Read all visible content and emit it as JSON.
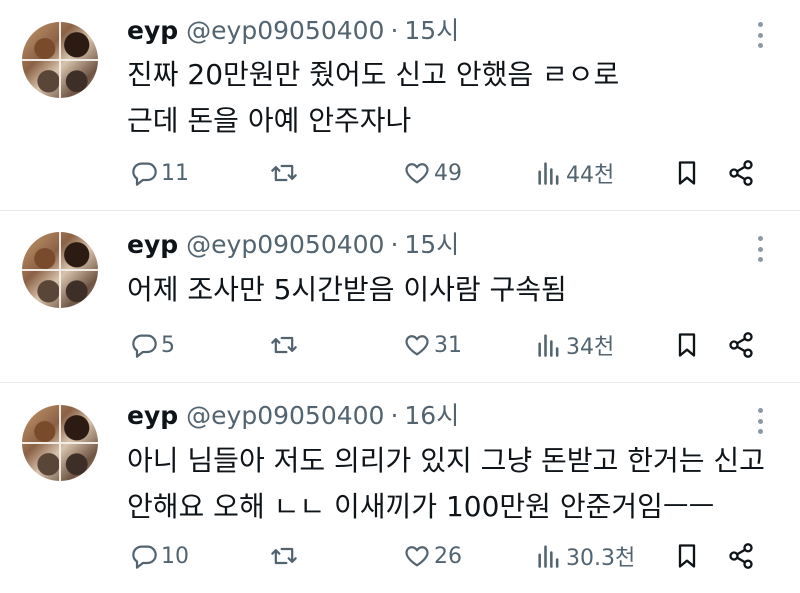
{
  "tweets": [
    {
      "name": "eyp",
      "handle": "@eyp09050400",
      "dot": "·",
      "time": "15시",
      "lines": [
        "진짜 20만원만 줬어도 신고 안했음 ㄹㅇ로",
        "근데 돈을 아예 안주자나"
      ],
      "replies": "11",
      "likes": "49",
      "views": "44천"
    },
    {
      "name": "eyp",
      "handle": "@eyp09050400",
      "dot": "·",
      "time": "15시",
      "lines": [
        "어제 조사만 5시간받음 이사람 구속됨"
      ],
      "replies": "5",
      "likes": "31",
      "views": "34천"
    },
    {
      "name": "eyp",
      "handle": "@eyp09050400",
      "dot": "·",
      "time": "16시",
      "lines": [
        "아니 님들아 저도 의리가 있지 그냥 돈받고 한거는 신고",
        "안해요 오해 ㄴㄴ 이새끼가 100만원 안준거임ㅡㅡ"
      ],
      "replies": "10",
      "likes": "26",
      "views": "30.3천"
    }
  ],
  "icons": {
    "reply": "reply-icon",
    "retweet": "retweet-icon",
    "like": "heart-icon",
    "views": "views-icon",
    "bookmark": "bookmark-icon",
    "share": "share-icon",
    "more": "more-icon"
  },
  "colors": {
    "text": "#0f1419",
    "muted": "#536471",
    "divider": "#e6e9eb"
  }
}
